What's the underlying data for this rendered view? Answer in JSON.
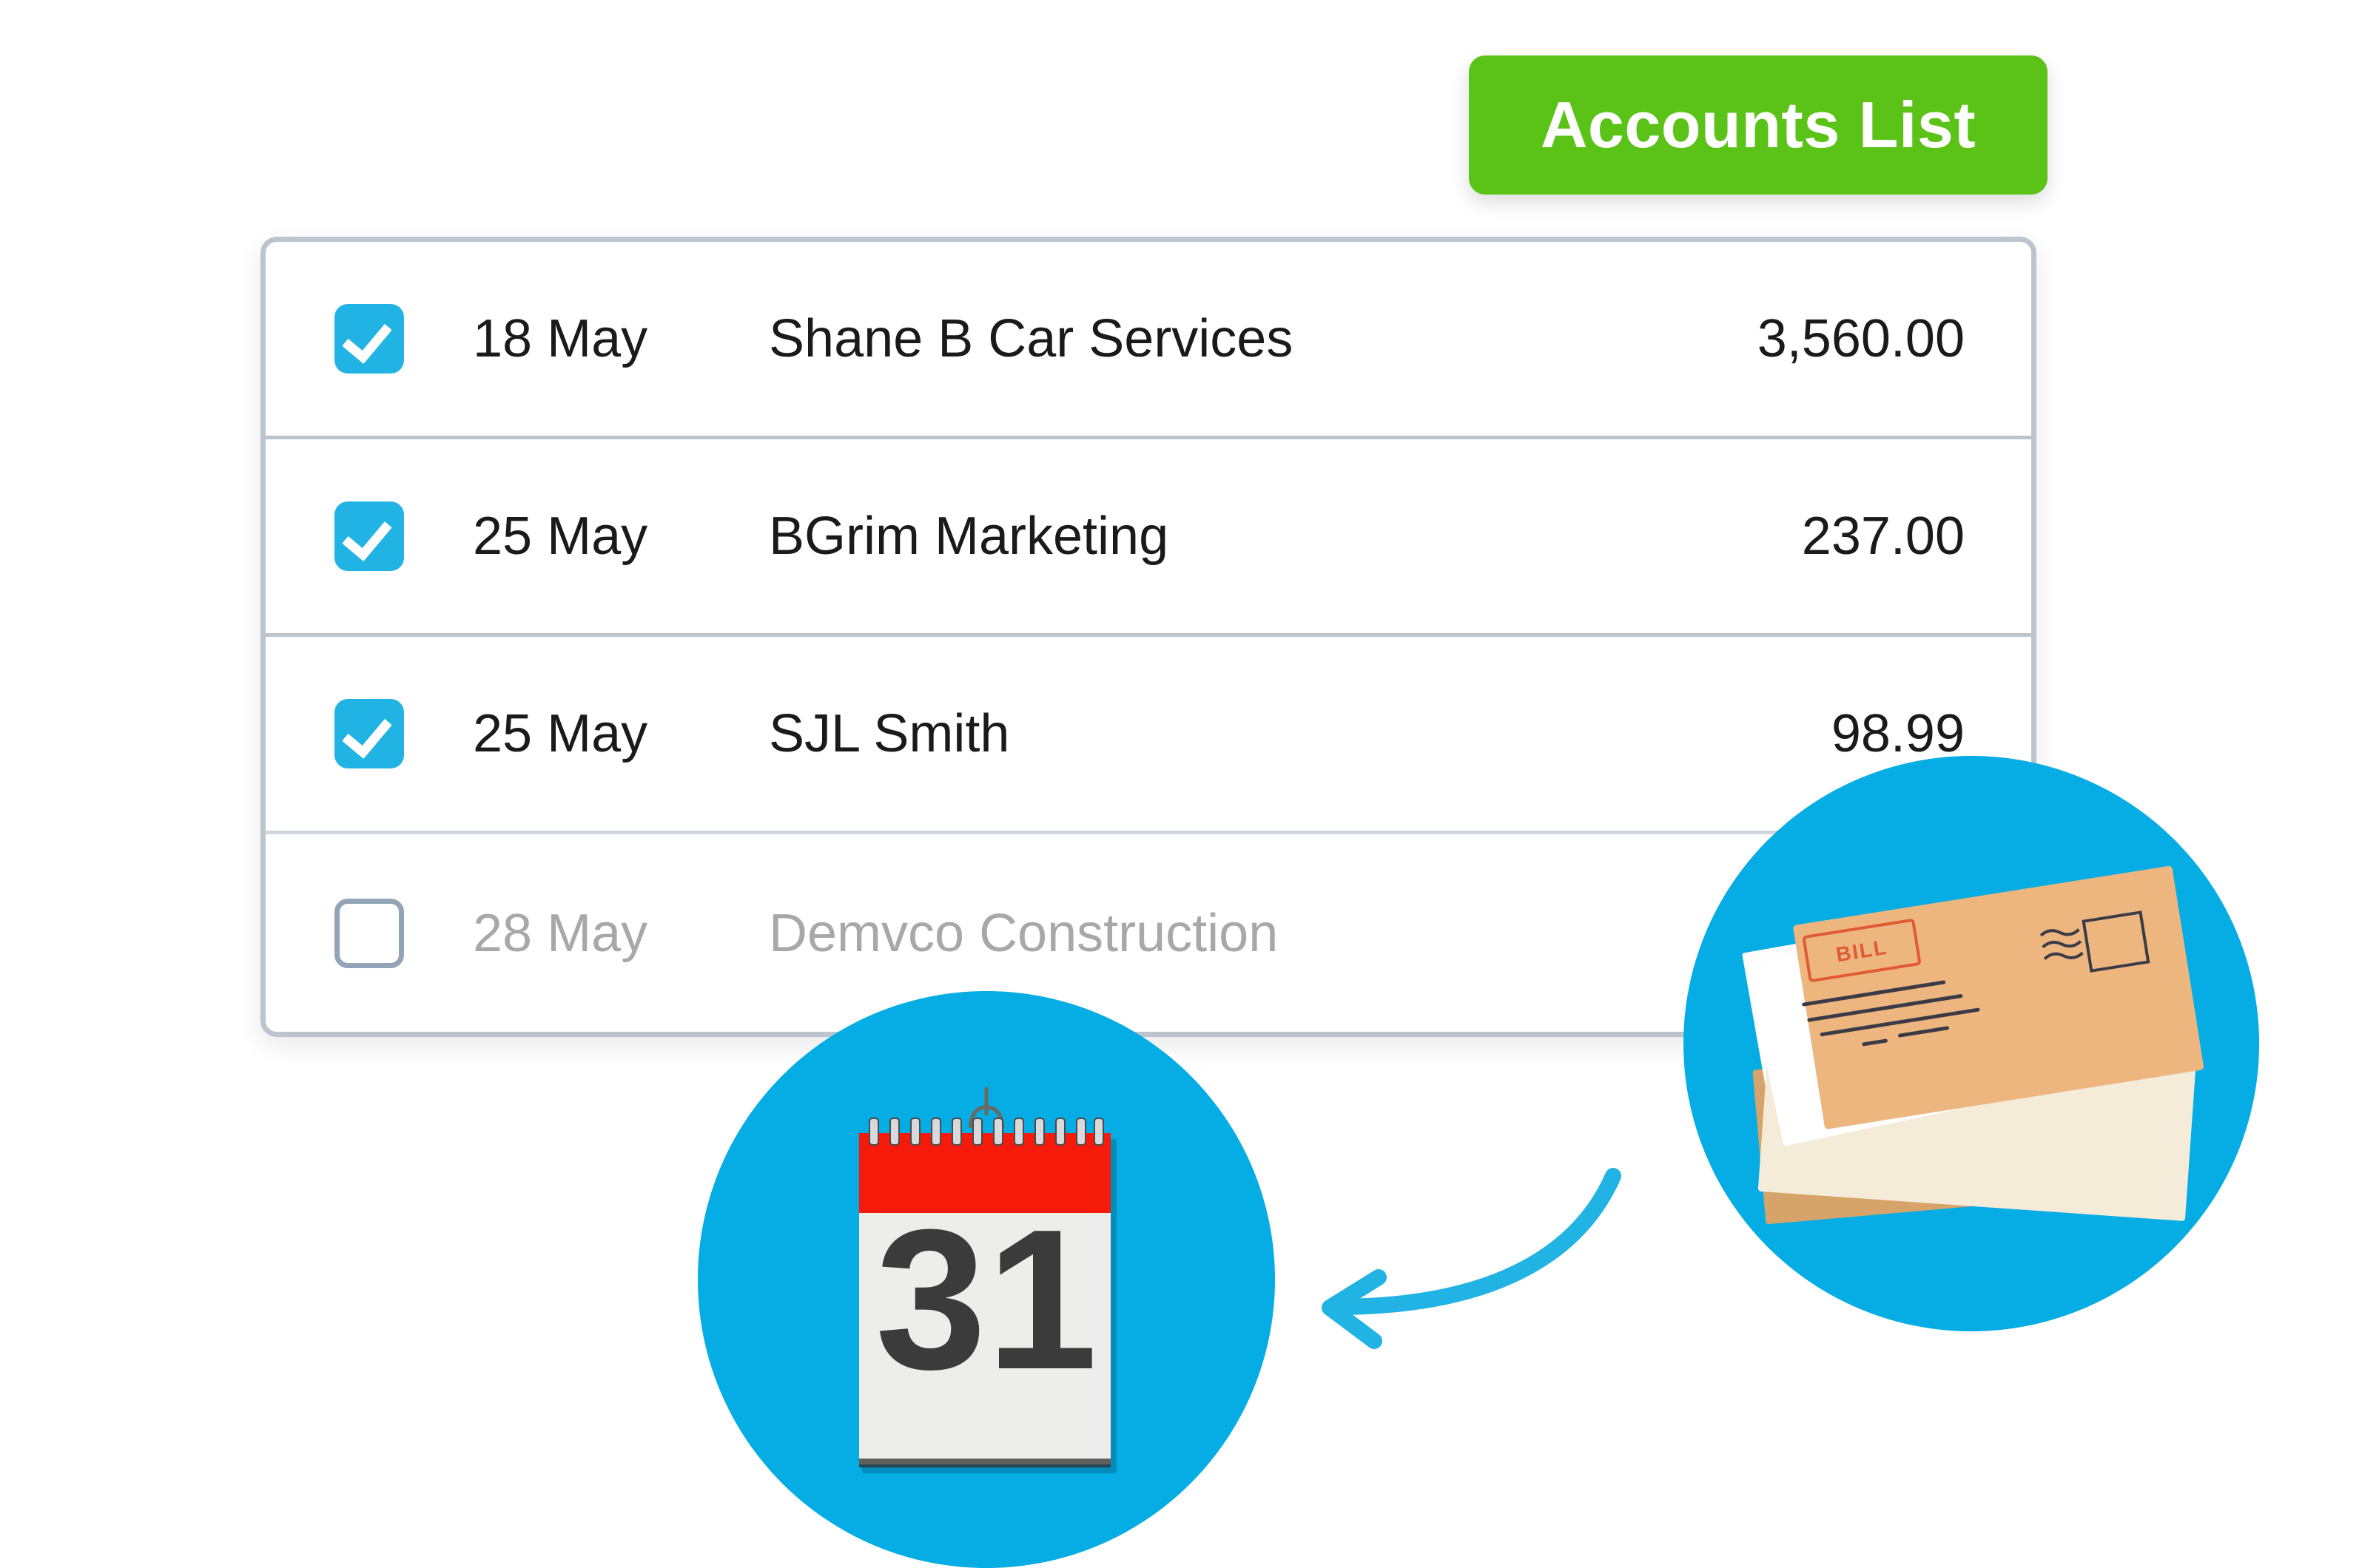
{
  "header": {
    "accounts_button_label": "Accounts List",
    "accounts_button_color": "#5bc217"
  },
  "colors": {
    "checkbox_checked": "#22b3e5",
    "checkbox_unchecked_border": "#93a4b6",
    "card_border": "#bcc5ce",
    "badge_circle": "#06ade4",
    "arrow": "#22b3e5",
    "muted_text": "#a8a8a8",
    "calendar_header_red": "#f61a0b"
  },
  "list": {
    "rows": [
      {
        "checked": true,
        "date": "18 May",
        "name": "Shane B Car Services",
        "amount": "3,560.00"
      },
      {
        "checked": true,
        "date": "25 May",
        "name": "BGrim Marketing",
        "amount": "237.00"
      },
      {
        "checked": true,
        "date": "25 May",
        "name": "SJL Smith",
        "amount": "98.99"
      },
      {
        "checked": false,
        "date": "28 May",
        "name": "Demvco Construction",
        "amount": ""
      }
    ]
  },
  "illustrations": {
    "calendar": {
      "icon": "calendar-icon",
      "day_number": "31"
    },
    "mail": {
      "icon": "mail-stack-icon",
      "stamp_label": "BILL"
    },
    "arrow": {
      "icon": "curved-arrow-left-icon"
    }
  }
}
